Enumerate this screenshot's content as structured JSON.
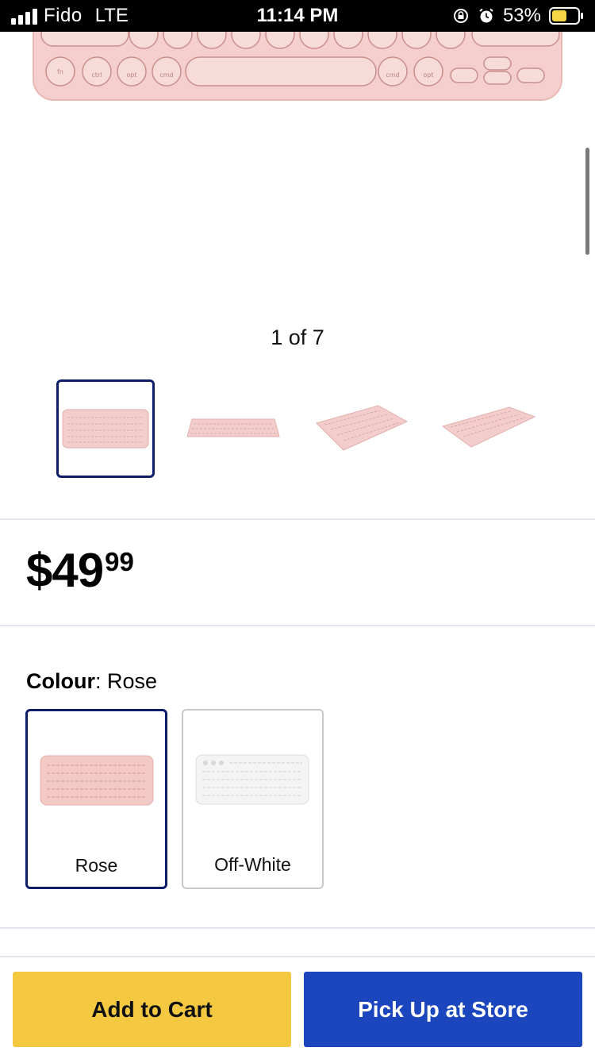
{
  "status_bar": {
    "carrier": "Fido",
    "network": "LTE",
    "time": "11:14 PM",
    "battery_percent": "53%",
    "icons": [
      "signal-icon",
      "orientation-lock-icon",
      "alarm-icon",
      "battery-icon"
    ],
    "battery_color": "#f5d547"
  },
  "gallery": {
    "counter": "1 of 7",
    "selected_index": 0,
    "thumbnails": [
      "keyboard-front",
      "keyboard-flat",
      "keyboard-angle-left",
      "keyboard-angle-right"
    ]
  },
  "price": {
    "dollars": "$49",
    "cents": "99"
  },
  "colour": {
    "label": "Colour",
    "value": "Rose",
    "options": [
      {
        "label": "Rose",
        "selected": true,
        "color": "#f2c9c6"
      },
      {
        "label": "Off-White",
        "selected": false,
        "color": "#f1f1f1"
      }
    ]
  },
  "actions": {
    "add_to_cart": "Add to Cart",
    "pick_up": "Pick Up at Store"
  },
  "colors": {
    "selected_border": "#0f1c6a",
    "add_to_cart_bg": "#f4c941",
    "pick_up_bg": "#1c46bd",
    "keyboard_rose": "#f2c9c6"
  }
}
